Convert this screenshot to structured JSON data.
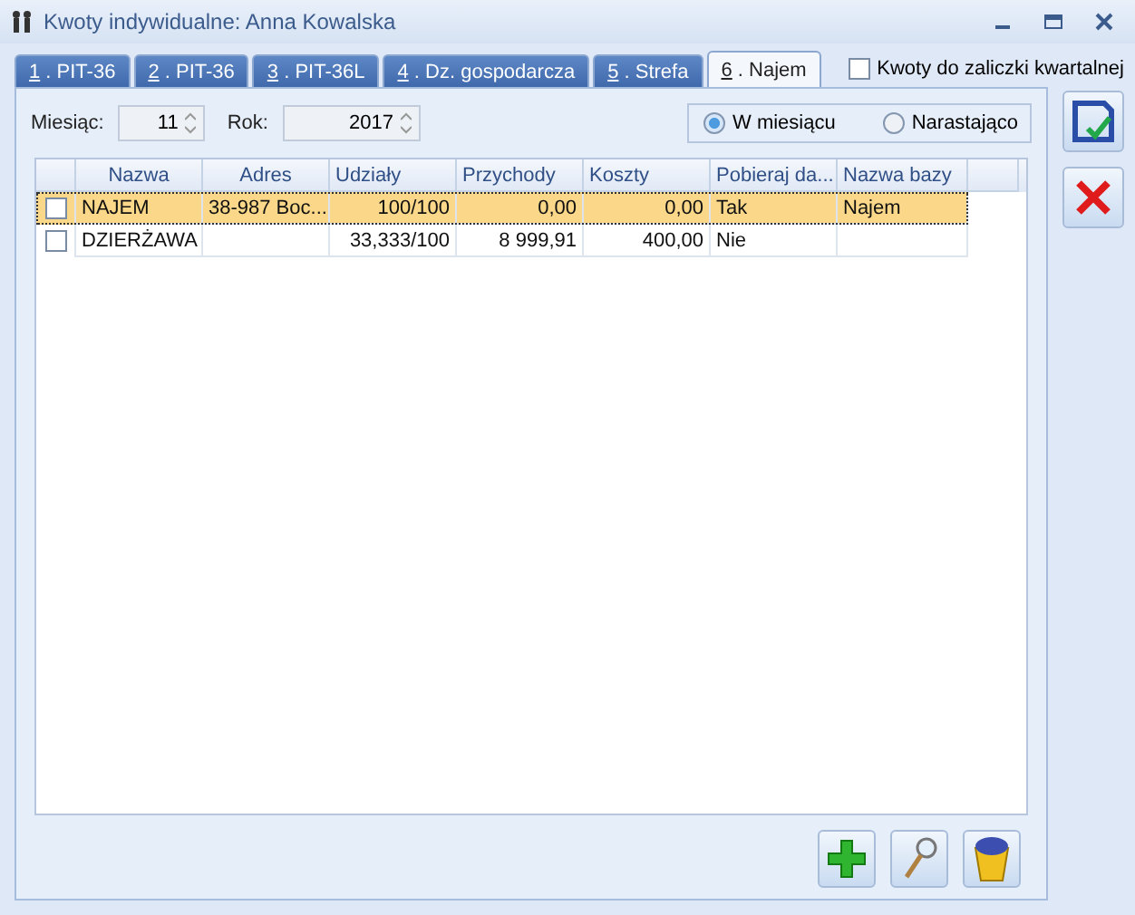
{
  "window": {
    "title": "Kwoty indywidualne: Anna Kowalska"
  },
  "tabs": [
    {
      "key": "1",
      "label": " . PIT-36",
      "selected": false
    },
    {
      "key": "2",
      "label": " . PIT-36",
      "selected": false
    },
    {
      "key": "3",
      "label": " . PIT-36L",
      "selected": false
    },
    {
      "key": "4",
      "label": " . Dz. gospodarcza",
      "selected": false
    },
    {
      "key": "5",
      "label": " . Strefa",
      "selected": false
    },
    {
      "key": "6",
      "label": " . Najem",
      "selected": true
    }
  ],
  "quarterly": {
    "label": "Kwoty do zaliczki kwartalnej",
    "checked": false
  },
  "month": {
    "label": "Miesiąc:",
    "value": "11"
  },
  "year": {
    "label": "Rok:",
    "value": "2017"
  },
  "mode": [
    {
      "label": "W miesiącu",
      "selected": true
    },
    {
      "label": "Narastająco",
      "selected": false
    }
  ],
  "table": {
    "columns": [
      "Nazwa",
      "Adres",
      "Udziały",
      "Przychody",
      "Koszty",
      "Pobieraj da...",
      "Nazwa bazy"
    ],
    "rows": [
      {
        "selected": true,
        "checked": false,
        "cells": [
          "NAJEM",
          "38-987 Boc...",
          "100/100",
          "0,00",
          "0,00",
          "Tak",
          "Najem"
        ]
      },
      {
        "selected": false,
        "checked": false,
        "cells": [
          "DZIERŻAWA",
          "",
          "33,333/100",
          "8 999,91",
          "400,00",
          "Nie",
          ""
        ]
      }
    ]
  }
}
